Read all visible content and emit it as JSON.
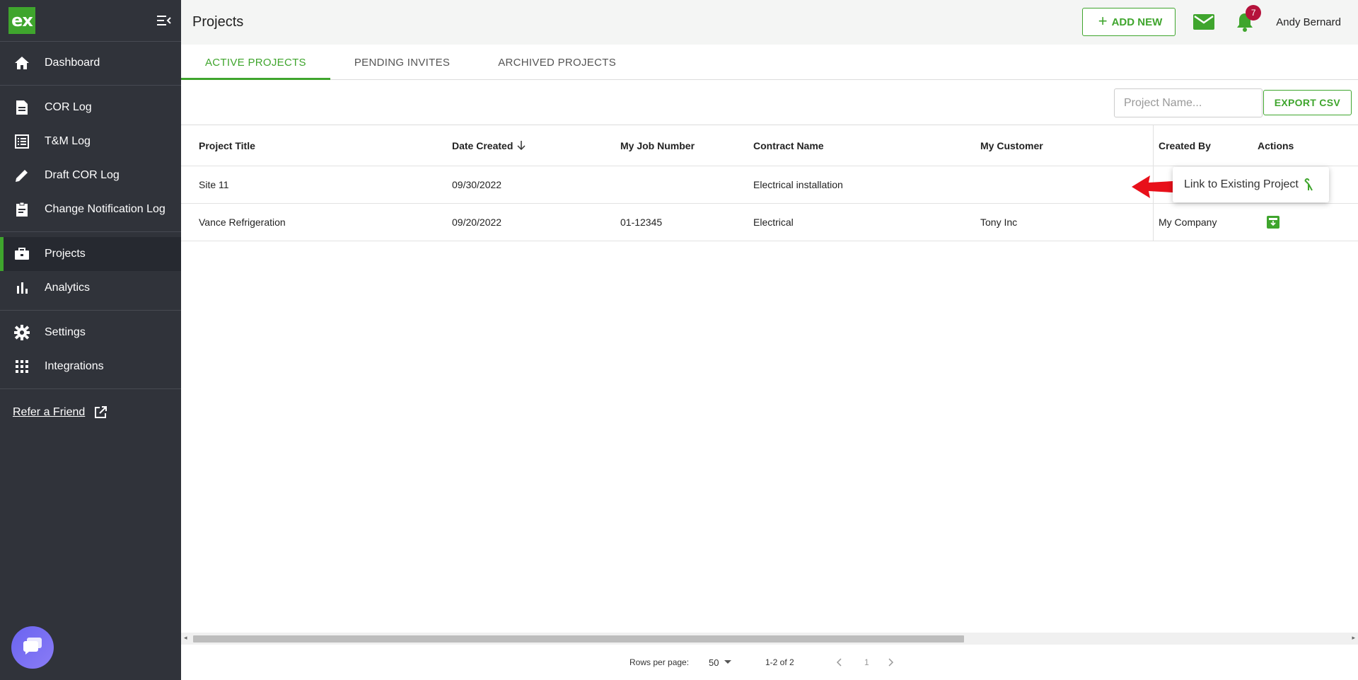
{
  "sidebar": {
    "logo_text": "ex",
    "items": [
      {
        "label": "Dashboard",
        "icon": "home-icon"
      },
      {
        "label": "COR Log",
        "icon": "document-icon"
      },
      {
        "label": "T&M Log",
        "icon": "list-icon"
      },
      {
        "label": "Draft COR Log",
        "icon": "pencil-icon"
      },
      {
        "label": "Change Notification Log",
        "icon": "clipboard-icon"
      },
      {
        "label": "Projects",
        "icon": "briefcase-icon"
      },
      {
        "label": "Analytics",
        "icon": "bar-chart-icon"
      },
      {
        "label": "Settings",
        "icon": "gear-icon"
      },
      {
        "label": "Integrations",
        "icon": "grid-icon"
      }
    ],
    "active_item": "Projects",
    "refer_label": "Refer a Friend"
  },
  "header": {
    "title": "Projects",
    "add_new_label": "ADD NEW",
    "notification_count": "7",
    "user_name": "Andy Bernard"
  },
  "tabs": [
    {
      "label": "ACTIVE PROJECTS",
      "active": true
    },
    {
      "label": "PENDING INVITES",
      "active": false
    },
    {
      "label": "ARCHIVED PROJECTS",
      "active": false
    }
  ],
  "toolbar": {
    "search_placeholder": "Project Name...",
    "search_value": "",
    "export_label": "EXPORT CSV"
  },
  "table": {
    "columns": [
      "Project Title",
      "Date Created",
      "My Job Number",
      "Contract Name",
      "My Customer",
      "Created By",
      "Actions"
    ],
    "rows": [
      {
        "title": "Site 11",
        "date": "09/30/2022",
        "job": "",
        "contract": "Electrical installation",
        "customer": "",
        "created_by": ""
      },
      {
        "title": "Vance Refrigeration",
        "date": "09/20/2022",
        "job": "01-12345",
        "contract": "Electrical",
        "customer": "Tony Inc",
        "created_by": "My Company"
      }
    ]
  },
  "popup": {
    "label": "Link to Existing Project"
  },
  "pagination": {
    "rows_per_page_label": "Rows per page:",
    "rows_per_page": "50",
    "range": "1-2 of 2",
    "page": "1"
  },
  "colors": {
    "accent": "#3fa52d",
    "sidebar_bg": "#30333a",
    "badge": "#b5123b",
    "arrow": "#e8101a"
  }
}
